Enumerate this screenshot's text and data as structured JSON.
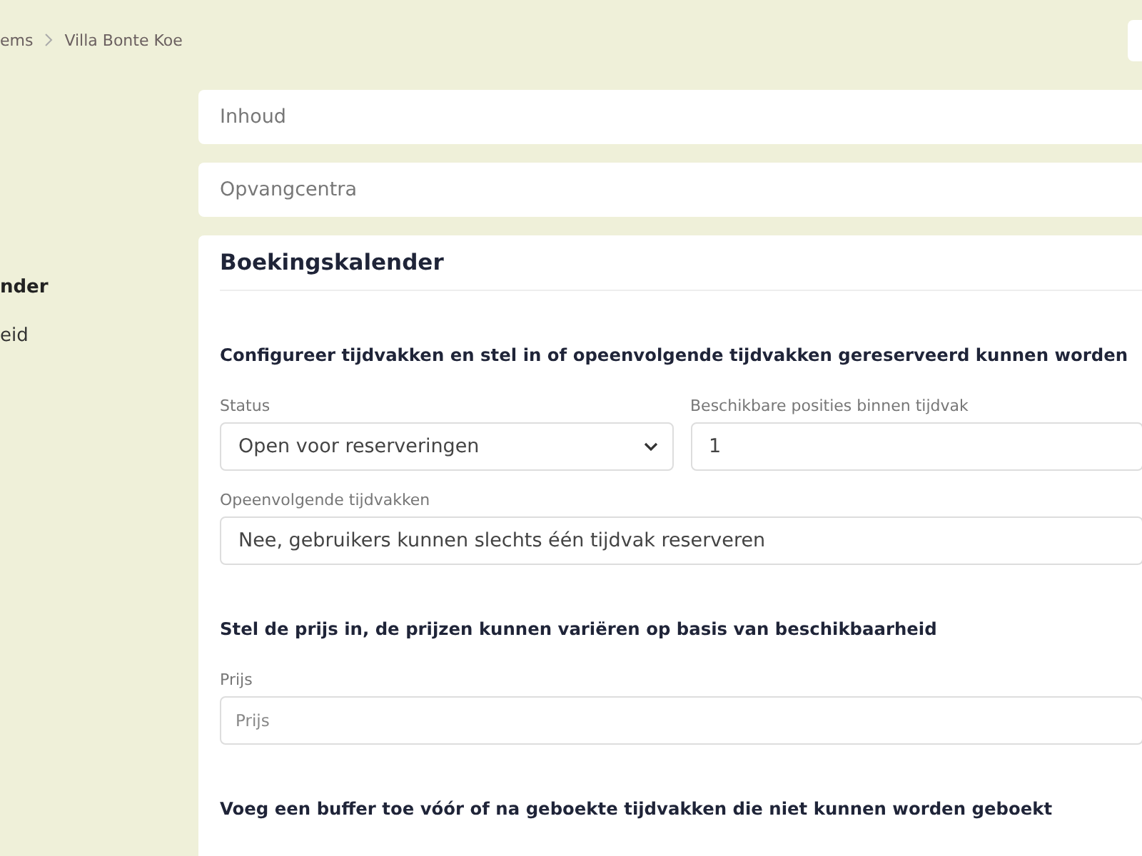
{
  "breadcrumb": [
    {
      "label": "ems"
    },
    {
      "label": "Villa Bonte Koe"
    }
  ],
  "sidebar": {
    "items": [
      {
        "label": "nder",
        "selected": true
      },
      {
        "label": "eid",
        "selected": false
      }
    ]
  },
  "collapsed_sections": [
    {
      "title": "Inhoud"
    },
    {
      "title": "Opvangcentra"
    }
  ],
  "booking": {
    "title": "Boekingskalender",
    "sections": [
      {
        "heading": "Configureer tijdvakken en stel in of opeenvolgende tijdvakken gereserveerd kunnen worden",
        "rows": [
          [
            {
              "kind": "select",
              "label": "Status",
              "value": "Open voor reserveringen"
            },
            {
              "kind": "input",
              "label": "Beschikbare posities binnen tijdvak",
              "value": "1"
            }
          ],
          [
            {
              "kind": "select_plain",
              "label": "Opeenvolgende tijdvakken",
              "value": "Nee, gebruikers kunnen slechts één tijdvak reserveren"
            }
          ]
        ]
      },
      {
        "heading": "Stel de prijs in, de prijzen kunnen variëren op basis van beschikbaarheid",
        "rows": [
          [
            {
              "kind": "input",
              "label": "Prijs",
              "placeholder": "Prijs"
            }
          ]
        ]
      },
      {
        "heading": "Voeg een buffer toe vóór of na geboekte tijdvakken die niet kunnen worden geboekt"
      }
    ]
  }
}
